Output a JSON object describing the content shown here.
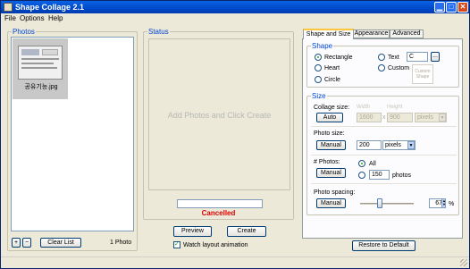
{
  "window": {
    "title": "Shape Collage 2.1"
  },
  "menu": {
    "items": [
      "File",
      "Options",
      "Help"
    ]
  },
  "photos": {
    "group_label": "Photos",
    "items": [
      {
        "filename": "공유기능.jpg"
      }
    ],
    "add_label": "+",
    "remove_label": "−",
    "clear_label": "Clear List",
    "count_label": "1 Photo"
  },
  "status": {
    "group_label": "Status",
    "message": "Add Photos and Click Create",
    "progress": 0,
    "result": "Cancelled",
    "preview_label": "Preview",
    "create_label": "Create",
    "watch_label": "Watch layout animation",
    "watch_checked": true
  },
  "tabs": [
    {
      "label": "Shape and Size",
      "active": true
    },
    {
      "label": "Appearance",
      "active": false
    },
    {
      "label": "Advanced",
      "active": false
    }
  ],
  "shape": {
    "group_label": "Shape",
    "rectangle": "Rectangle",
    "heart": "Heart",
    "circle": "Circle",
    "text": "Text",
    "custom": "Custom",
    "text_value": "C",
    "browse_label": "...",
    "custom_line1": "Custom",
    "custom_line2": "Shape",
    "selected": "rectangle"
  },
  "size": {
    "group_label": "Size",
    "collage_label": "Collage size:",
    "collage_mode": "Auto",
    "width_label": "Width",
    "height_label": "Height",
    "width_value": "1600",
    "height_value": "900",
    "times": "x",
    "collage_unit": "pixels",
    "photo_label": "Photo size:",
    "photo_mode": "Manual",
    "photo_value": "200",
    "photo_unit": "pixels",
    "count_label": "# Photos:",
    "count_mode": "Manual",
    "all_label": "All",
    "count_value": "150",
    "count_unit": "photos",
    "count_selected": "all",
    "spacing_label": "Photo spacing:",
    "spacing_mode": "Manual",
    "spacing_value": "67",
    "spacing_unit": "%"
  },
  "footer": {
    "restore_label": "Restore to Default"
  },
  "colors": {
    "title_bar": "#0054e3",
    "group_label": "#0046d5",
    "status_error": "#e00000"
  }
}
